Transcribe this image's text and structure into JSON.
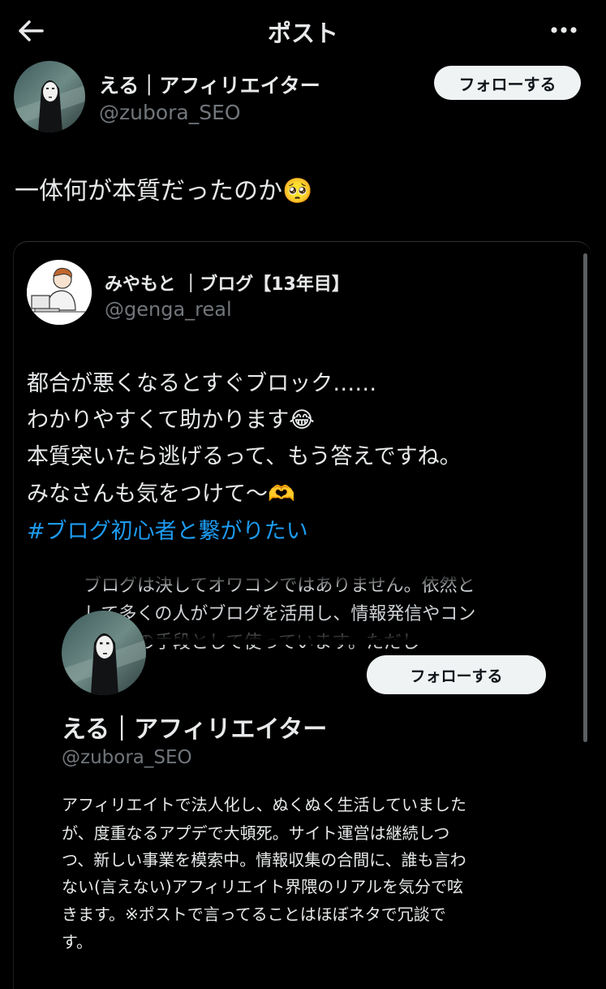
{
  "header": {
    "title": "ポスト",
    "back_icon": "arrow-left-icon",
    "more_icon": "more-horizontal-icon"
  },
  "post": {
    "author_name": "える｜アフィリエイター",
    "author_handle": "@zubora_SEO",
    "follow_label": "フォローする",
    "text": "一体何が本質だったのか🥺"
  },
  "quote": {
    "author_name": "みやもと ｜ブログ【13年目】",
    "author_handle": "@genga_real",
    "lines": [
      "都合が悪くなるとすぐブロック……",
      "わかりやすくて助かります😂",
      "本質突いたら逃げるって、もう答えですね。",
      "みなさんも気をつけて〜🫶"
    ],
    "hashtag": "#ブログ初心者と繋がりたい"
  },
  "background_fragment": {
    "lines": [
      "ブログは決してオワコンではありません。依然と",
      "して多くの人がブログを活用し、情報発信やコン",
      "ツ共有の手段として使っています。ただし"
    ]
  },
  "profile_popup": {
    "name": "える｜アフィリエイター",
    "handle": "@zubora_SEO",
    "follow_label": "フォローする",
    "bio_lines": [
      "アフィリエイトで法人化し、ぬくぬく生活していました",
      "が、度重なるアプデで大頓死。サイト運営は継続しつ",
      "つ、新しい事業を模索中。情報収集の合間に、誰も言わ",
      "ない(言えない)アフィリエイト界隈のリアルを気分で呟",
      "きます。※ポストで言ってることはほぼネタで冗談で",
      "す。"
    ]
  },
  "colors": {
    "background": "#000000",
    "text": "#e7e9ea",
    "secondary_text": "#71767b",
    "link": "#1d9bf0",
    "button_bg": "#eff3f4"
  }
}
